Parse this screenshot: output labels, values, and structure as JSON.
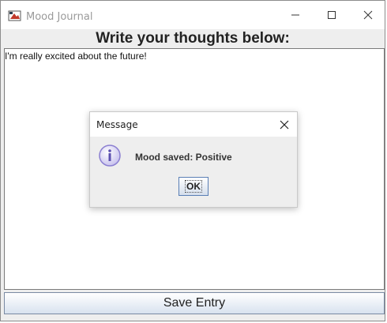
{
  "window": {
    "title": "Mood Journal",
    "icon": "java-app-icon",
    "controls": [
      "minimize-icon",
      "maximize-icon",
      "close-icon"
    ]
  },
  "main": {
    "heading": "Write your thoughts below:",
    "entry_text": "I'm really excited about the future!",
    "save_label": "Save Entry"
  },
  "dialog": {
    "title": "Message",
    "icon": "info-icon",
    "message": "Mood saved: Positive",
    "ok_label": "OK"
  },
  "colors": {
    "info_icon": "#8b7fd1",
    "button_border": "#5a7fb5"
  }
}
